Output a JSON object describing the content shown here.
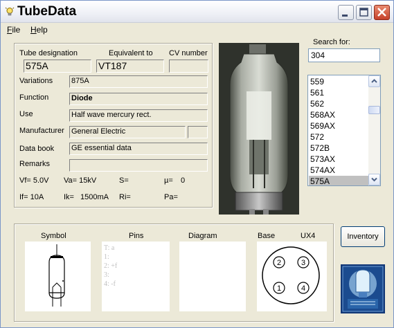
{
  "window": {
    "title": "TubeData"
  },
  "menu": {
    "file": "File",
    "file_mnemonic": "F",
    "file_rest": "ile",
    "help": "Help",
    "help_mnemonic": "H",
    "help_rest": "elp"
  },
  "header": {
    "tube_designation_label": "Tube designation",
    "equivalent_label": "Equivalent to",
    "cv_label": "CV number",
    "tube_designation": "575A",
    "equivalent": "VT187",
    "cv_number": ""
  },
  "fields": {
    "variations_label": "Variations",
    "variations": "875A",
    "function_label": "Function",
    "function": "Diode",
    "use_label": "Use",
    "use": "Half wave mercury rect.",
    "manufacturer_label": "Manufacturer",
    "manufacturer": "General Electric",
    "manufacturer_extra": "",
    "databook_label": "Data book",
    "databook": "GE essential data",
    "remarks_label": "Remarks",
    "remarks": ""
  },
  "specs": {
    "vf": "Vf= 5.0V",
    "va": "Va= 15kV",
    "s": "S=",
    "mu": "µ=",
    "mu_value": "0",
    "if": "If= 10A",
    "ik_label": "Ik=",
    "ik_value": "1500mA",
    "ri": "Ri=",
    "pa": "Pa="
  },
  "search": {
    "label": "Search for:",
    "value": "304"
  },
  "list": {
    "items": [
      "559",
      "561",
      "562",
      "568AX",
      "569AX",
      "572",
      "572B",
      "573AX",
      "574AX",
      "575A"
    ],
    "selected": "575A"
  },
  "bottom": {
    "symbol_label": "Symbol",
    "pins_label": "Pins",
    "diagram_label": "Diagram",
    "base_label": "Base",
    "base_type": "UX4",
    "pins": [
      "T: a",
      "1:",
      "2: +f",
      "3:",
      "4: -f"
    ],
    "base_pins": [
      "2",
      "3",
      "1",
      "4"
    ]
  },
  "buttons": {
    "inventory": "Inventory"
  }
}
